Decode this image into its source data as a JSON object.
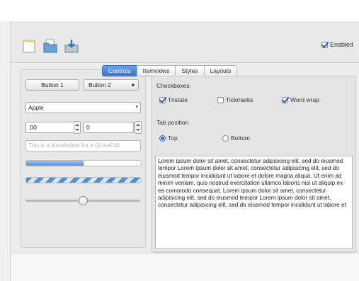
{
  "toolbar": {
    "icons": [
      "new-file-icon",
      "open-folder-icon",
      "save-icon"
    ],
    "enabled_label": "Enabled",
    "enabled_checked": true
  },
  "left": {
    "button1": "Button 1",
    "button2": "Button 2",
    "button2_arrow": "▾",
    "combo_value": "Apple",
    "combo_arrow": "▾",
    "spin1": ".00",
    "spin2": "0",
    "lineedit_placeholder": "This is a placeholder for a QLineEdit",
    "progress_value": 0.5,
    "slider_value": 0.5
  },
  "tabs": [
    "Controls",
    "Itemviews",
    "Styles",
    "Layouts"
  ],
  "controls": {
    "checkboxes_title": "Checkboxes",
    "checkboxes": [
      {
        "label": "Tristate",
        "checked": true
      },
      {
        "label": "Tickmarks",
        "checked": false
      },
      {
        "label": "Word wrap",
        "checked": true
      }
    ],
    "tab_position_title": "Tab position",
    "radios": [
      {
        "label": "Top",
        "checked": true
      },
      {
        "label": "Bottom",
        "checked": false
      }
    ],
    "text": "Lorem ipsum dolor sit amet, consectetur adipisicing elit, sed do eiusmod tempor Lorem ipsum dolor sit amet, consectetur adipisicing elit, sed do eiusmod tempor incididunt ut labore et dolore magna aliqua. Ut enim ad minim veniam, quis nostrud exercitation ullamco laboris nisi ut aliquip ex ea commodo consequat. Lorem ipsum dolor sit amet, consectetur adipisicing elit, sed do eiusmod tempor Lorem ipsum dolor sit amet, consectetur adipisicing elit, sed do eiusmod tempor incididunt ut labore et"
  }
}
